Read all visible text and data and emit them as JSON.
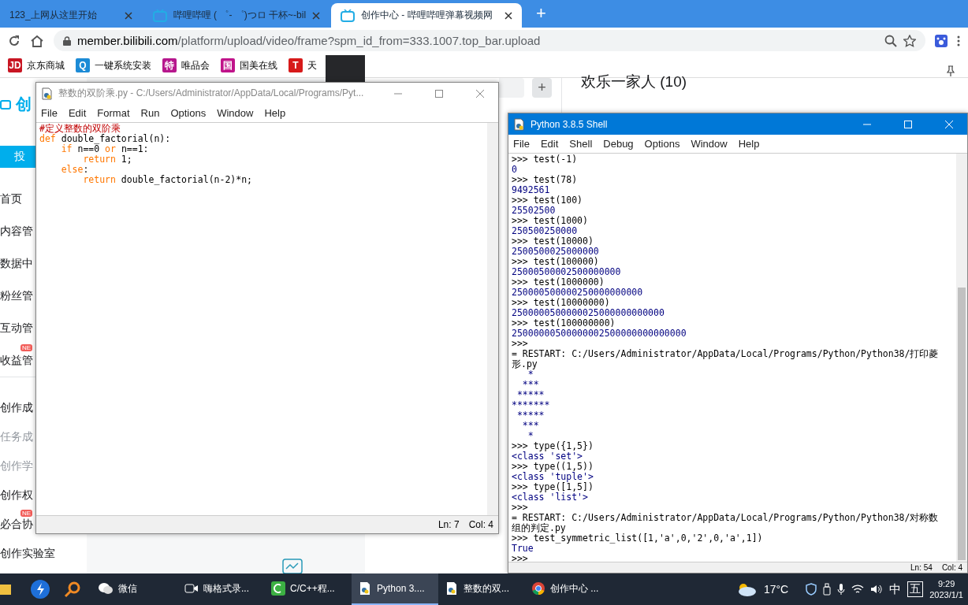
{
  "browser": {
    "tabs": [
      {
        "title": "123_上网从这里开始",
        "selected": false
      },
      {
        "title": "哔哩哔哩 ( ゜- ゜)つロ 干杯~-bil",
        "selected": false
      },
      {
        "title": "创作中心 - 哔哩哔哩弹幕视频网",
        "selected": true
      }
    ],
    "new_tab": "+",
    "url_host": "member.bilibili.com",
    "url_path": "/platform/upload/video/frame?spm_id_from=333.1007.top_bar.upload",
    "bookmarks": [
      {
        "badge": "JD",
        "label": "京东商城",
        "color": "#c81623"
      },
      {
        "badge": "Q",
        "label": "一键系统安装",
        "color": "#1c8bd6"
      },
      {
        "badge": "特",
        "label": "唯品会",
        "color": "#b6178d"
      },
      {
        "badge": "国",
        "label": "国美在线",
        "color": "#c0148a"
      },
      {
        "badge": "T",
        "label": "天",
        "color": "#d71a1a"
      }
    ]
  },
  "page": {
    "logo": "创",
    "upload_button": "投",
    "sidebar": [
      {
        "label": "首页",
        "dimmed": false
      },
      {
        "label": "内容管",
        "dimmed": false
      },
      {
        "label": "数据中",
        "dimmed": false
      },
      {
        "label": "粉丝管",
        "dimmed": false
      },
      {
        "label": "互动管",
        "dimmed": false
      },
      {
        "label": "收益管",
        "dimmed": false,
        "badge": "NE"
      },
      {
        "label": "创作成",
        "dimmed": false
      },
      {
        "label": "任务成",
        "dimmed": true
      },
      {
        "label": "创作学",
        "dimmed": true
      },
      {
        "label": "创作权",
        "dimmed": false
      },
      {
        "label": "必合协",
        "dimmed": false,
        "badge": "NE"
      },
      {
        "label": "创作实验室",
        "dimmed": false
      }
    ],
    "add_button": "+",
    "group_title": "欢乐一家人 (10)"
  },
  "editor": {
    "title": "整数的双阶乘.py - C:/Users/Administrator/AppData/Local/Programs/Pyt...",
    "active": false,
    "menu": [
      "File",
      "Edit",
      "Format",
      "Run",
      "Options",
      "Window",
      "Help"
    ],
    "code": [
      {
        "segments": [
          {
            "kind": "comment",
            "text": "#定义整数的双阶乘"
          }
        ]
      },
      {
        "segments": [
          {
            "kind": "keyword",
            "text": "def"
          },
          {
            "kind": "plain",
            "text": " double_factorial(n):"
          }
        ]
      },
      {
        "segments": [
          {
            "kind": "keyword",
            "text": "    if"
          },
          {
            "kind": "plain",
            "text": " n==0 "
          },
          {
            "kind": "keyword",
            "text": "or"
          },
          {
            "kind": "plain",
            "text": " n==1:"
          }
        ]
      },
      {
        "segments": [
          {
            "kind": "keyword",
            "text": "        return"
          },
          {
            "kind": "plain",
            "text": " 1;"
          }
        ]
      },
      {
        "segments": [
          {
            "kind": "keyword",
            "text": "    else"
          },
          {
            "kind": "plain",
            "text": ":"
          }
        ]
      },
      {
        "segments": [
          {
            "kind": "keyword",
            "text": "        return"
          },
          {
            "kind": "plain",
            "text": " double_factorial(n-2)*n;"
          }
        ]
      }
    ],
    "status": [
      "Ln: 7",
      "Col: 4"
    ]
  },
  "shell": {
    "title": "Python 3.8.5 Shell",
    "active": true,
    "menu": [
      "File",
      "Edit",
      "Shell",
      "Debug",
      "Options",
      "Window",
      "Help"
    ],
    "lines": [
      {
        "kind": "input",
        "text": ">>> test(-1)"
      },
      {
        "kind": "output",
        "text": "0"
      },
      {
        "kind": "input",
        "text": ">>> test(78)"
      },
      {
        "kind": "output",
        "text": "9492561"
      },
      {
        "kind": "input",
        "text": ">>> test(100)"
      },
      {
        "kind": "output",
        "text": "25502500"
      },
      {
        "kind": "input",
        "text": ">>> test(1000)"
      },
      {
        "kind": "output",
        "text": "250500250000"
      },
      {
        "kind": "input",
        "text": ">>> test(10000)"
      },
      {
        "kind": "output",
        "text": "2500500025000000"
      },
      {
        "kind": "input",
        "text": ">>> test(100000)"
      },
      {
        "kind": "output",
        "text": "25000500002500000000"
      },
      {
        "kind": "input",
        "text": ">>> test(1000000)"
      },
      {
        "kind": "output",
        "text": "250000500000250000000000"
      },
      {
        "kind": "input",
        "text": ">>> test(10000000)"
      },
      {
        "kind": "output",
        "text": "2500000500000025000000000000"
      },
      {
        "kind": "input",
        "text": ">>> test(100000000)"
      },
      {
        "kind": "output",
        "text": "25000000500000002500000000000000"
      },
      {
        "kind": "input",
        "text": ">>>"
      },
      {
        "kind": "restart",
        "text": "= RESTART: C:/Users/Administrator/AppData/Local/Programs/Python/Python38/打印菱"
      },
      {
        "kind": "restart",
        "text": "形.py"
      },
      {
        "kind": "output",
        "text": "   *\n  ***\n *****\n*******\n *****\n  ***\n   *"
      },
      {
        "kind": "input",
        "text": ">>> type({1,5})"
      },
      {
        "kind": "output",
        "text": "<class 'set'>"
      },
      {
        "kind": "input",
        "text": ">>> type((1,5))"
      },
      {
        "kind": "output",
        "text": "<class 'tuple'>"
      },
      {
        "kind": "input",
        "text": ">>> type([1,5])"
      },
      {
        "kind": "output",
        "text": "<class 'list'>"
      },
      {
        "kind": "input",
        "text": ">>>"
      },
      {
        "kind": "restart",
        "text": "= RESTART: C:/Users/Administrator/AppData/Local/Programs/Python/Python38/对称数"
      },
      {
        "kind": "restart",
        "text": "组的判定.py"
      },
      {
        "kind": "input",
        "text": ">>> test_symmetric_list([1,'a',0,'2',0,'a',1])"
      },
      {
        "kind": "output",
        "text": "True"
      },
      {
        "kind": "input",
        "text": ">>>"
      }
    ],
    "status": [
      "Ln: 54",
      "Col: 4"
    ]
  },
  "taskbar": {
    "items": [
      {
        "kind": "wechat",
        "label": "微信",
        "selected": false
      },
      {
        "kind": "recorder",
        "label": "嗨格式录...",
        "selected": false
      },
      {
        "kind": "cpp",
        "label": "C/C++程...",
        "selected": false
      },
      {
        "kind": "python",
        "label": "Python 3....",
        "selected": true
      },
      {
        "kind": "python",
        "label": "整数的双...",
        "selected": false
      },
      {
        "kind": "chrome",
        "label": "创作中心 ...",
        "selected": false
      }
    ],
    "weather": "17°C",
    "ime": "中",
    "ime_mode": "五",
    "time": "9:29",
    "date": "2023/1/1"
  }
}
